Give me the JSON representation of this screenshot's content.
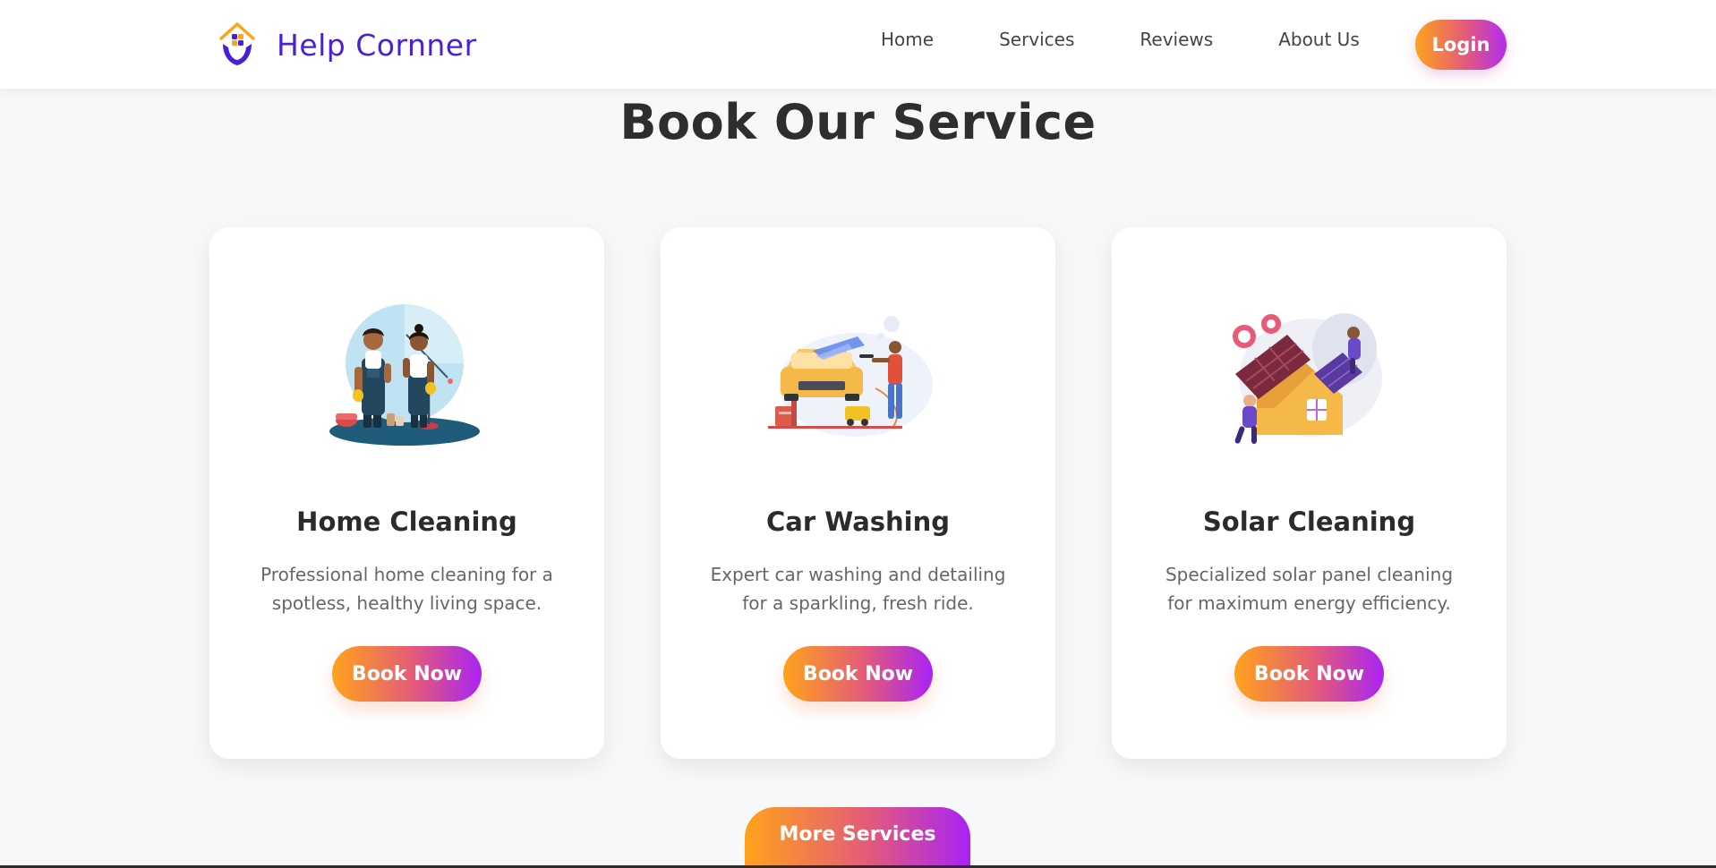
{
  "header": {
    "brand_name": "Help Cornner",
    "nav": [
      "Home",
      "Services",
      "Reviews",
      "About Us"
    ],
    "login_label": "Login"
  },
  "main": {
    "title": "Book Our Service",
    "cards": [
      {
        "title": "Home Cleaning",
        "description": "Professional home cleaning for a spotless, healthy living space.",
        "button_label": "Book Now",
        "illustration": "home-cleaning-illustration"
      },
      {
        "title": "Car Washing",
        "description": "Expert car washing and detailing for a sparkling, fresh ride.",
        "button_label": "Book Now",
        "illustration": "car-washing-illustration"
      },
      {
        "title": "Solar Cleaning",
        "description": "Specialized solar panel cleaning for maximum energy efficiency.",
        "button_label": "Book Now",
        "illustration": "solar-cleaning-illustration"
      }
    ],
    "more_label": "More Services"
  },
  "colors": {
    "brand": "#4a1fd6",
    "gradient_start": "#ffa31a",
    "gradient_end": "#a823f5",
    "background": "#f7f8fa"
  }
}
